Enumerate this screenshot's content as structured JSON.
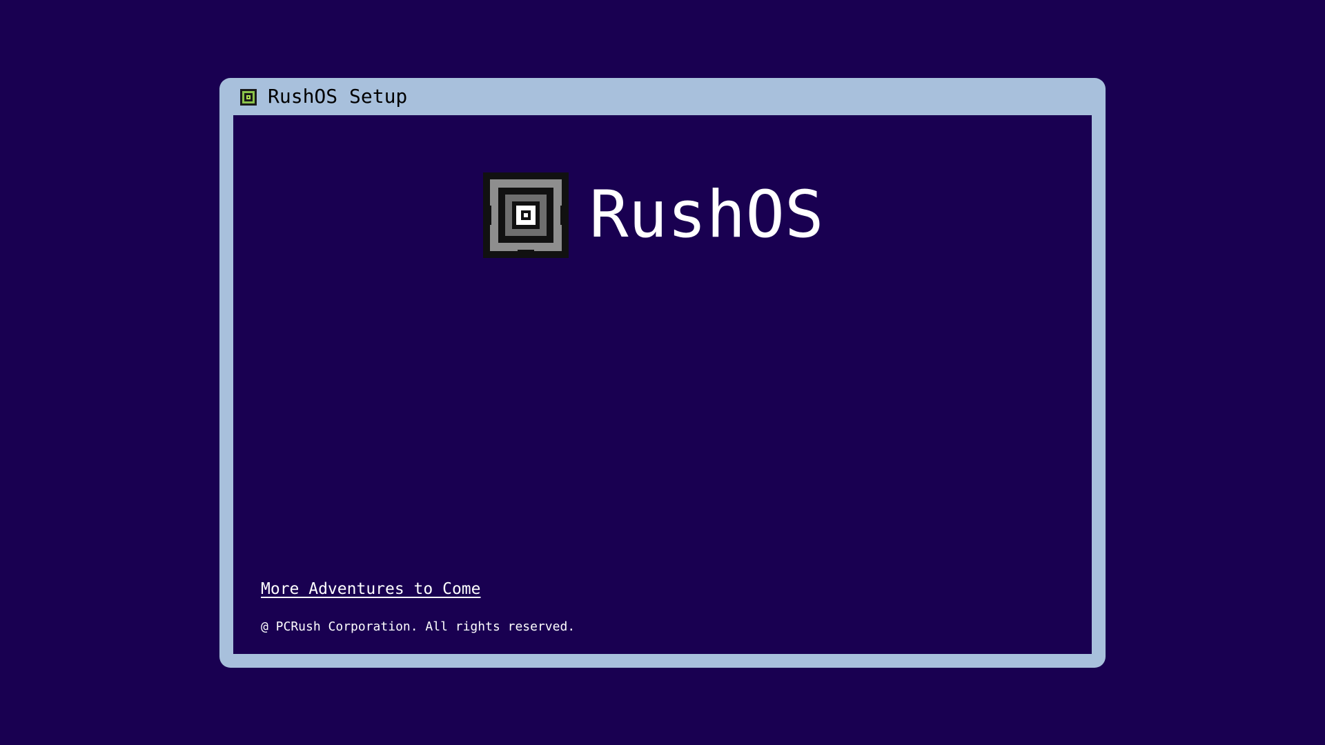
{
  "window": {
    "title": "RushOS Setup",
    "title_icon": "rushos-logo-icon"
  },
  "main": {
    "brand_name": "RushOS",
    "brand_logo": "rushos-logo"
  },
  "footer": {
    "link_text": "More Adventures to Come",
    "copyright": "@ PCRush Corporation. All rights reserved."
  },
  "colors": {
    "background": "#190051",
    "window_frame": "#a8c0dc",
    "text": "#ffffff",
    "icon_accent": "#b0e050"
  }
}
